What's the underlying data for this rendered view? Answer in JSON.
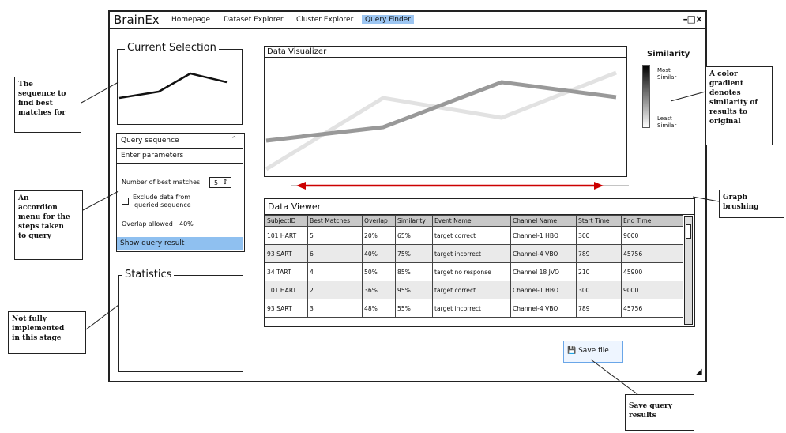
{
  "app": {
    "title": "BrainEx",
    "nav": [
      "Homepage",
      "Dataset Explorer",
      "Cluster Explorer",
      "Query Finder"
    ],
    "window_controls": "–□×"
  },
  "left": {
    "current_selection": "Current Selection",
    "accordion": {
      "query_sequence": "Query sequence",
      "enter_parameters": "Enter parameters",
      "num_best_label": "Number of best matches",
      "num_best_value": "5",
      "exclude_label_1": "Exclude data from",
      "exclude_label_2": "queried sequence",
      "overlap_label": "Overlap allowed",
      "overlap_value": "40%",
      "show_result": "Show query result"
    },
    "statistics": "Statistics"
  },
  "visualizer": {
    "title": "Data Visualizer",
    "similarity_title": "Similarity",
    "most_1": "Most",
    "most_2": "Similar",
    "least_1": "Least",
    "least_2": "Similar"
  },
  "viewer": {
    "title": "Data Viewer",
    "columns": [
      "SubjectID",
      "Best Matches",
      "Overlap",
      "Similarity",
      "Event Name",
      "Channel Name",
      "Start Time",
      "End Time"
    ],
    "rows": [
      [
        "101 HART",
        "5",
        "20%",
        "65%",
        "target correct",
        "Channel-1 HBO",
        "300",
        "9000"
      ],
      [
        "93 SART",
        "6",
        "40%",
        "75%",
        "target incorrect",
        "Channel-4 VBO",
        "789",
        "45756"
      ],
      [
        "34 TART",
        "4",
        "50%",
        "85%",
        "target no response",
        "Channel 18 JVO",
        "210",
        "45900"
      ],
      [
        "101 HART",
        "2",
        "36%",
        "95%",
        "target correct",
        "Channel-1 HBO",
        "300",
        "9000"
      ],
      [
        "93 SART",
        "3",
        "48%",
        "55%",
        "target incorrect",
        "Channel-4 VBO",
        "789",
        "45756"
      ]
    ],
    "save_label": "Save file"
  },
  "annotations": {
    "sequence": [
      "The",
      "sequence to",
      "find best",
      "matches for"
    ],
    "accordion": [
      "An",
      "accordion",
      "menu for the",
      "steps taken",
      "to query"
    ],
    "statistics": [
      "Not fully",
      "implemented",
      "in this stage"
    ],
    "gradient": [
      "A color",
      "gradient",
      "denotes",
      "similarity  of",
      "results to",
      "original"
    ],
    "brushing": [
      "Graph",
      "brushing"
    ],
    "save": [
      "Save query",
      "results"
    ]
  }
}
